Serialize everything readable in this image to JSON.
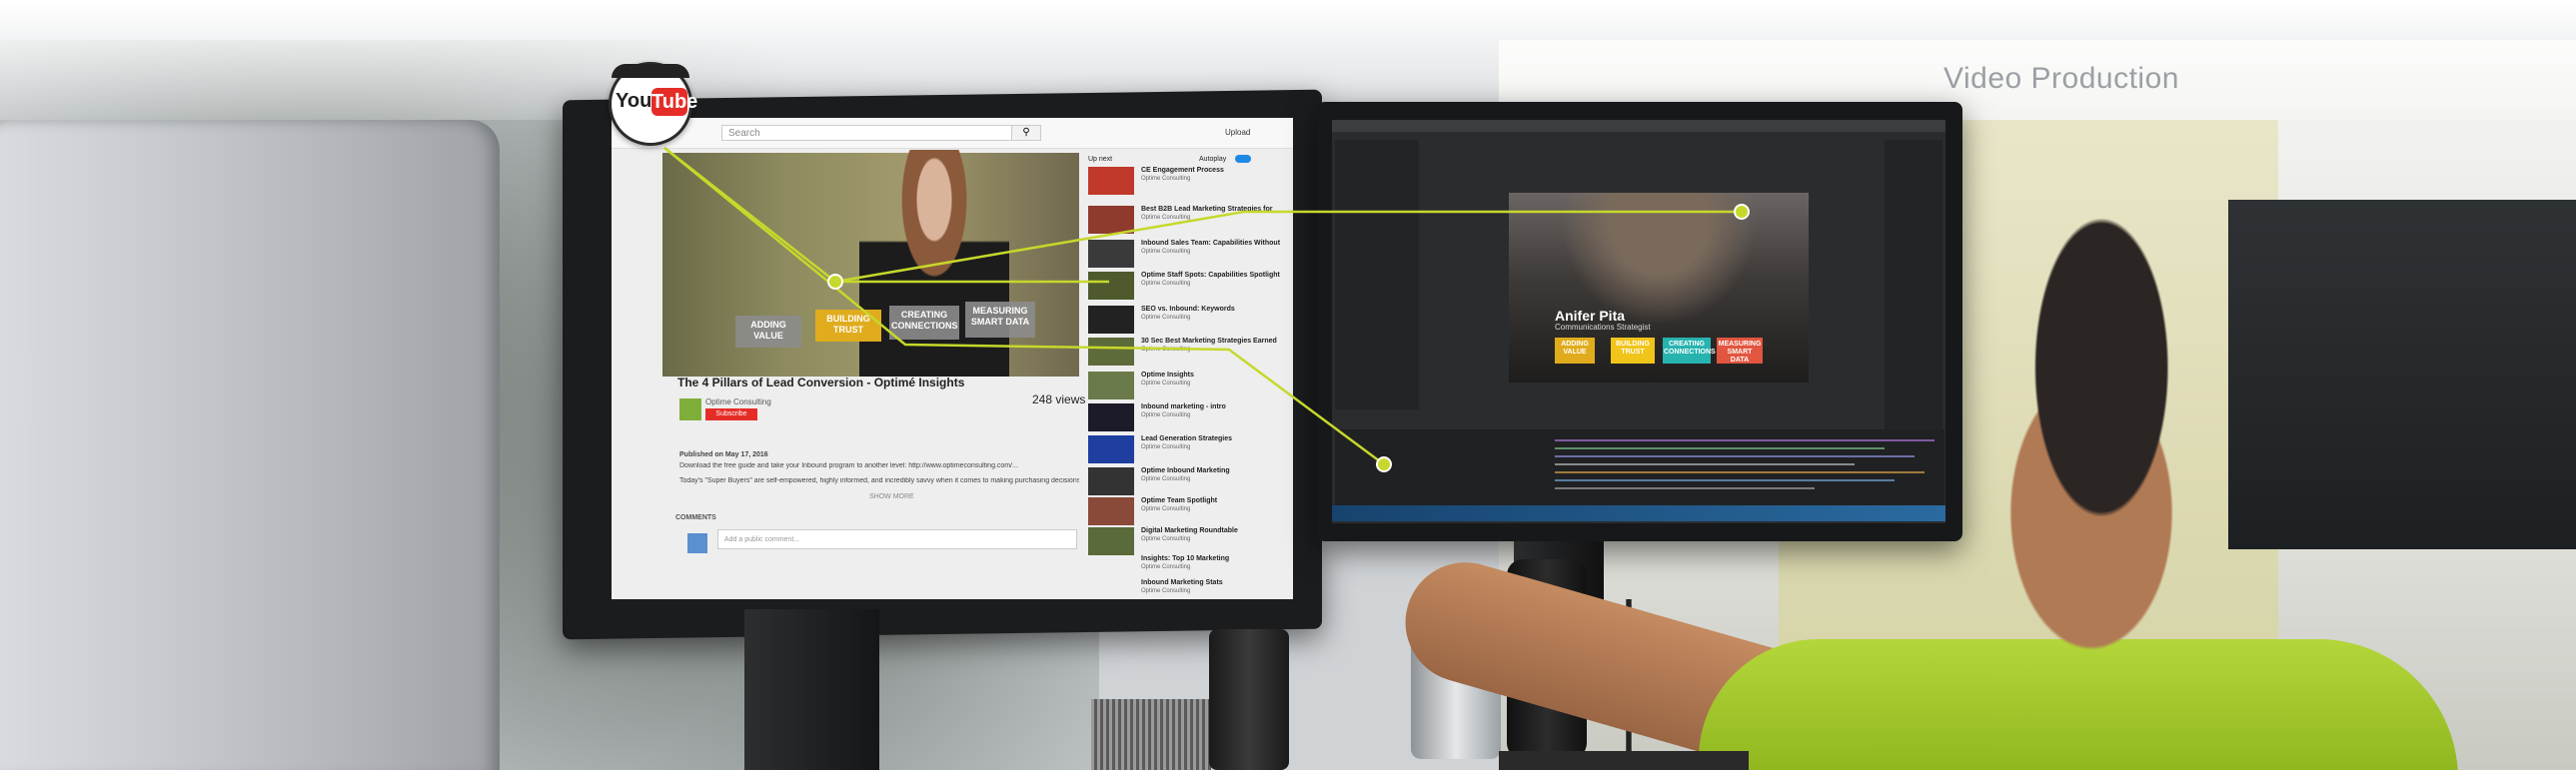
{
  "scene": {
    "wall_sign": "Video Production"
  },
  "youtube_badge": {
    "you": "You",
    "tube": "Tube"
  },
  "youtube_page": {
    "search_placeholder": "Search",
    "upload_label": "Upload",
    "up_next": "Up next",
    "autoplay": "Autoplay",
    "video_title": "The 4 Pillars of Lead Conversion - Optimé Insights",
    "channel": "Optime Consulting",
    "subscribe": "Subscribe",
    "views": "248 views",
    "published": "Published on May 17, 2016",
    "description": "Download the free guide and take your Inbound program to another level: http://www.optimeconsulting.com/...",
    "description2": "Today's \"Super Buyers\" are self-empowered, highly informed, and incredibly savvy when it comes to making purchasing decisions...",
    "show_more": "SHOW MORE",
    "comments_label": "COMMENTS",
    "comment_placeholder": "Add a public comment...",
    "player_pills": [
      "ADDING VALUE",
      "BUILDING TRUST",
      "CREATING CONNECTIONS",
      "MEASURING SMART DATA"
    ],
    "sidebar": [
      {
        "title": "CE Engagement Process",
        "sub": "Optime Consulting"
      },
      {
        "title": "Best B2B Lead Marketing Strategies for",
        "sub": "Optime Consulting"
      },
      {
        "title": "Inbound Sales Team: Capabilities Without",
        "sub": "Optime Consulting"
      },
      {
        "title": "Optime Staff Spots: Capabilities Spotlight",
        "sub": "Optime Consulting"
      },
      {
        "title": "SEO vs. Inbound: Keywords",
        "sub": "Optime Consulting"
      },
      {
        "title": "30 Sec Best Marketing Strategies Earned",
        "sub": "Optime Consulting"
      },
      {
        "title": "Optime Insights",
        "sub": "Optime Consulting"
      },
      {
        "title": "Inbound marketing - intro",
        "sub": "Optime Consulting"
      },
      {
        "title": "Lead Generation Strategies",
        "sub": "Optime Consulting"
      },
      {
        "title": "Optime Inbound Marketing",
        "sub": "Optime Consulting"
      },
      {
        "title": "Optime Team Spotlight",
        "sub": "Optime Consulting"
      },
      {
        "title": "Digital Marketing Roundtable",
        "sub": "Optime Consulting"
      },
      {
        "title": "Insights: Top 10 Marketing",
        "sub": "Optime Consulting"
      },
      {
        "title": "Inbound Marketing Stats",
        "sub": "Optime Consulting"
      }
    ]
  },
  "ae_viewer": {
    "name": "Anifer Pita",
    "role": "Communications Strategist",
    "pills": [
      "ADDING VALUE",
      "BUILDING TRUST",
      "CREATING CONNECTIONS",
      "MEASURING SMART DATA"
    ]
  },
  "colors": {
    "callout_line": "#c6d82b",
    "youtube_red": "#e52d27",
    "pill_gold": "#e0ac1e",
    "pill_yellow": "#f0c419",
    "pill_teal": "#27b3b0",
    "pill_red": "#e2553e",
    "shirt_green": "#a8cf2e"
  },
  "icons": [
    "youtube-logo-icon",
    "search-icon",
    "callout-dot-icon"
  ]
}
